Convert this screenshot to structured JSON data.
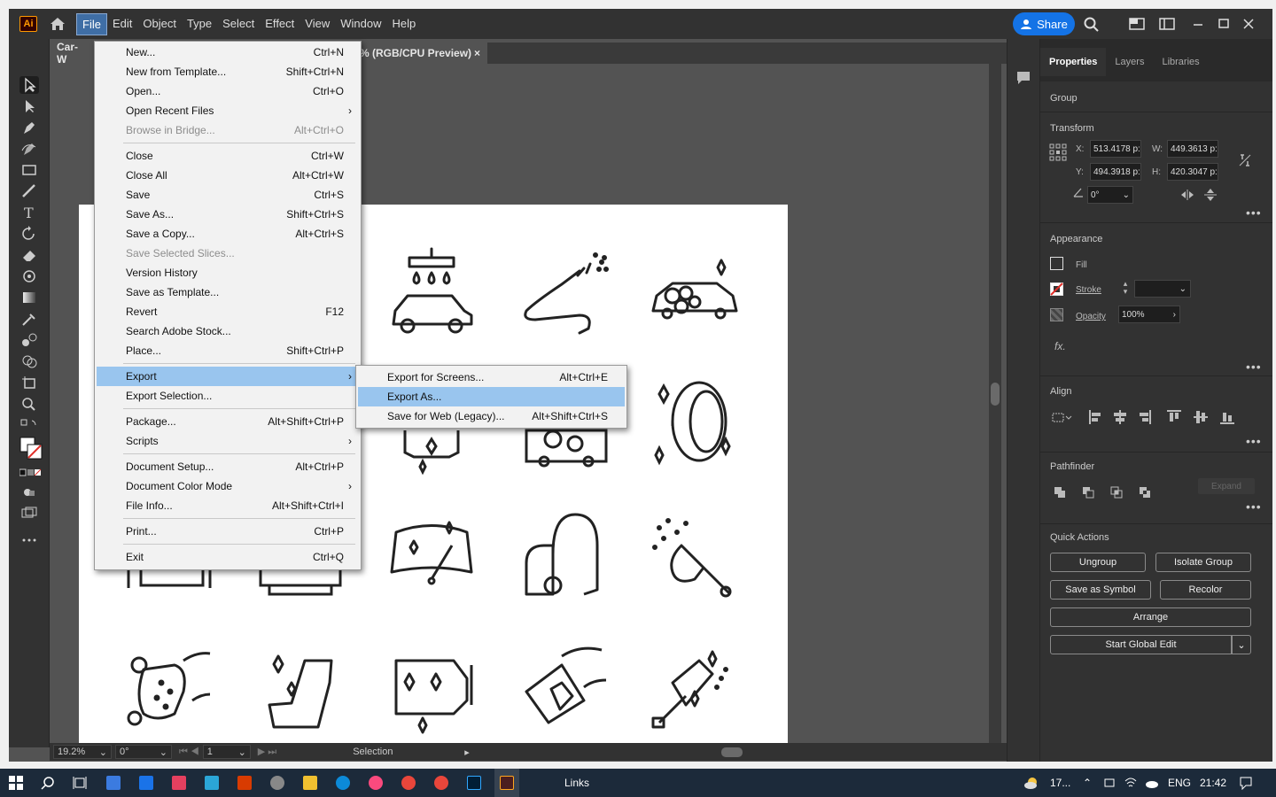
{
  "app": {
    "logo": "Ai",
    "menus": [
      "File",
      "Edit",
      "Object",
      "Type",
      "Select",
      "Effect",
      "View",
      "Window",
      "Help"
    ],
    "share_label": "Share"
  },
  "document": {
    "tab_left": "Car-W",
    "tab_right": "% (RGB/CPU Preview)",
    "close_glyph": "×"
  },
  "file_menu": {
    "items": [
      {
        "label": "New...",
        "shortcut": "Ctrl+N"
      },
      {
        "label": "New from Template...",
        "shortcut": "Shift+Ctrl+N"
      },
      {
        "label": "Open...",
        "shortcut": "Ctrl+O"
      },
      {
        "label": "Open Recent Files",
        "shortcut": ""
      },
      {
        "label": "Browse in Bridge...",
        "shortcut": "Alt+Ctrl+O"
      },
      {
        "label": "Close",
        "shortcut": "Ctrl+W"
      },
      {
        "label": "Close All",
        "shortcut": "Alt+Ctrl+W"
      },
      {
        "label": "Save",
        "shortcut": "Ctrl+S"
      },
      {
        "label": "Save As...",
        "shortcut": "Shift+Ctrl+S"
      },
      {
        "label": "Save a Copy...",
        "shortcut": "Alt+Ctrl+S"
      },
      {
        "label": "Save Selected Slices...",
        "shortcut": ""
      },
      {
        "label": "Version History",
        "shortcut": ""
      },
      {
        "label": "Save as Template...",
        "shortcut": ""
      },
      {
        "label": "Revert",
        "shortcut": "F12"
      },
      {
        "label": "Search Adobe Stock...",
        "shortcut": ""
      },
      {
        "label": "Place...",
        "shortcut": "Shift+Ctrl+P"
      },
      {
        "label": "Export",
        "shortcut": ""
      },
      {
        "label": "Export Selection...",
        "shortcut": ""
      },
      {
        "label": "Package...",
        "shortcut": "Alt+Shift+Ctrl+P"
      },
      {
        "label": "Scripts",
        "shortcut": ""
      },
      {
        "label": "Document Setup...",
        "shortcut": "Alt+Ctrl+P"
      },
      {
        "label": "Document Color Mode",
        "shortcut": ""
      },
      {
        "label": "File Info...",
        "shortcut": "Alt+Shift+Ctrl+I"
      },
      {
        "label": "Print...",
        "shortcut": "Ctrl+P"
      },
      {
        "label": "Exit",
        "shortcut": "Ctrl+Q"
      }
    ],
    "arrow_glyph": "›"
  },
  "export_menu": {
    "items": [
      {
        "label": "Export for Screens...",
        "shortcut": "Alt+Ctrl+E"
      },
      {
        "label": "Export As...",
        "shortcut": ""
      },
      {
        "label": "Save for Web (Legacy)...",
        "shortcut": "Alt+Shift+Ctrl+S"
      }
    ]
  },
  "properties": {
    "tabs": [
      "Properties",
      "Layers",
      "Libraries"
    ],
    "selection_type": "Group",
    "transform": {
      "title": "Transform",
      "x_label": "X:",
      "x_value": "513.4178 p:",
      "y_label": "Y:",
      "y_value": "494.3918 p:",
      "w_label": "W:",
      "w_value": "449.3613 p:",
      "h_label": "H:",
      "h_value": "420.3047 p:",
      "angle_value": "0°"
    },
    "appearance": {
      "title": "Appearance",
      "fill_label": "Fill",
      "stroke_label": "Stroke",
      "opacity_label": "Opacity",
      "opacity_value": "100%",
      "fx_label": "fx."
    },
    "align_title": "Align",
    "pathfinder_title": "Pathfinder",
    "expand_label": "Expand",
    "quick_actions": {
      "title": "Quick Actions",
      "ungroup": "Ungroup",
      "isolate": "Isolate Group",
      "save_symbol": "Save as Symbol",
      "recolor": "Recolor",
      "arrange": "Arrange",
      "global_edit": "Start Global Edit"
    },
    "more_glyph": "•••"
  },
  "status": {
    "zoom": "19.2%",
    "rotation": "0°",
    "artboard_num": "1",
    "tool": "Selection"
  },
  "taskbar": {
    "weather": "17...",
    "links_label": "Links",
    "language": "ENG",
    "time": "21:42"
  },
  "colors": {
    "accent": "#1473e6",
    "menu_highlight": "#99c5ee",
    "panel_bg": "#323232",
    "canvas_bg": "#535353",
    "stroke_swatch": "#e0302a"
  }
}
